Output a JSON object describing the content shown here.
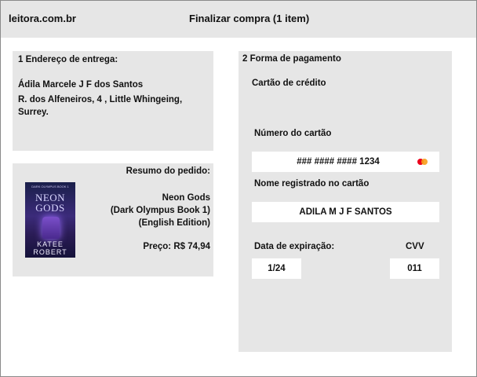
{
  "header": {
    "site_name": "leitora.com.br",
    "page_title": "Finalizar compra (1 item)"
  },
  "address": {
    "heading": "1 Endereço de entrega:",
    "name": "Ádila Marcele J F dos Santos",
    "street": "R. dos Alfeneiros, 4 ,  Little Whingeing, Surrey."
  },
  "order": {
    "heading": "Resumo do pedido:",
    "book_cover": {
      "top_text": "DARK OLYMPUS BOOK 1",
      "title": "NEON GODS",
      "author": "KATEE ROBERT"
    },
    "book_title_line1": "Neon Gods",
    "book_title_line2": "(Dark Olympus Book 1)",
    "book_title_line3": "(English Edition)",
    "price": "Preço: R$ 74,94"
  },
  "payment": {
    "heading": "2 Forma de pagamento",
    "method": "Cartão de crédito",
    "card_number_label": "Número do cartão",
    "card_number_value": "### #### #### 1234",
    "card_brand_icon": "mastercard-icon",
    "name_label": "Nome registrado no cartão",
    "name_value": "ADILA M J F SANTOS",
    "expiration_label": "Data de expiração:",
    "expiration_value": "1/24",
    "cvv_label": "CVV",
    "cvv_value": "011"
  }
}
